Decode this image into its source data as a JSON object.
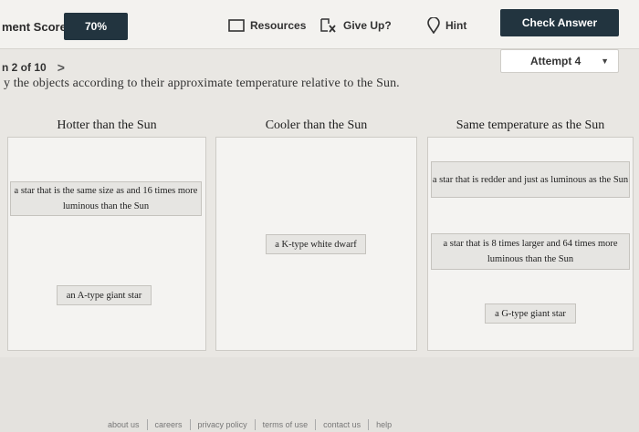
{
  "toolbar": {
    "score_label": "ment Score:",
    "score_value": "70%",
    "resources_label": "Resources",
    "giveup_label": "Give Up?",
    "hint_label": "Hint",
    "check_label": "Check Answer",
    "icons": {
      "resources": "square-outline-icon",
      "giveup": "flag-x-icon",
      "hint": "location-pin-icon"
    }
  },
  "question": {
    "nav_text": "n 2 of 10",
    "next_arrow": ">",
    "attempt_label": "Attempt 4",
    "instruction": "y the objects according to their approximate temperature relative to the Sun."
  },
  "columns": [
    {
      "heading": "Hotter than the Sun",
      "items": [
        "a star that is the same size as and 16 times more luminous than the Sun",
        "an A-type giant star"
      ]
    },
    {
      "heading": "Cooler than the Sun",
      "items": [
        "a K-type white dwarf"
      ]
    },
    {
      "heading": "Same temperature as the Sun",
      "items": [
        "a star that is redder and just as luminous as the Sun",
        "a star that is 8 times larger and 64 times more luminous than the Sun",
        "a G-type giant star"
      ]
    }
  ],
  "footer": {
    "links": [
      "about us",
      "careers",
      "privacy policy",
      "terms of use",
      "contact us",
      "help"
    ]
  },
  "colors": {
    "dark_button": "#22343f",
    "background": "#e9e7e3",
    "card": "#e6e5e2"
  }
}
